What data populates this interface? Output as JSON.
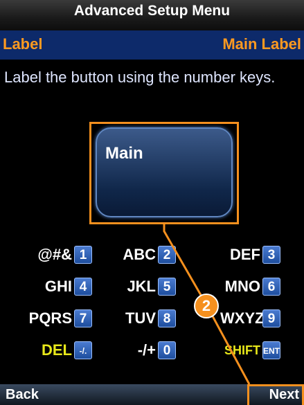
{
  "title": "Advanced Setup Menu",
  "header": {
    "left": "Label",
    "right": "Main Label"
  },
  "instruction": "Label the button using the number keys.",
  "preview_button": {
    "label": "Main"
  },
  "keypad": [
    [
      {
        "text": "@#&",
        "key": "1"
      },
      {
        "text": "ABC",
        "key": "2"
      },
      {
        "text": "DEF",
        "key": "3"
      }
    ],
    [
      {
        "text": "GHI",
        "key": "4"
      },
      {
        "text": "JKL",
        "key": "5"
      },
      {
        "text": "MNO",
        "key": "6"
      }
    ],
    [
      {
        "text": "PQRS",
        "key": "7"
      },
      {
        "text": "TUV",
        "key": "8"
      },
      {
        "text": "WXYZ",
        "key": "9"
      }
    ],
    [
      {
        "text": "DEL",
        "key": "-/."
      },
      {
        "text": "-/+",
        "key": "0"
      },
      {
        "text": "SHIFT",
        "key": "ENT"
      }
    ]
  ],
  "footer": {
    "back": "Back",
    "next": "Next"
  },
  "callout": {
    "number": "2"
  },
  "colors": {
    "accent": "#f5901e",
    "header_bg": "#0d2a6a",
    "key_blue": "#2a5db0",
    "highlight_yellow": "#e8e81a"
  }
}
